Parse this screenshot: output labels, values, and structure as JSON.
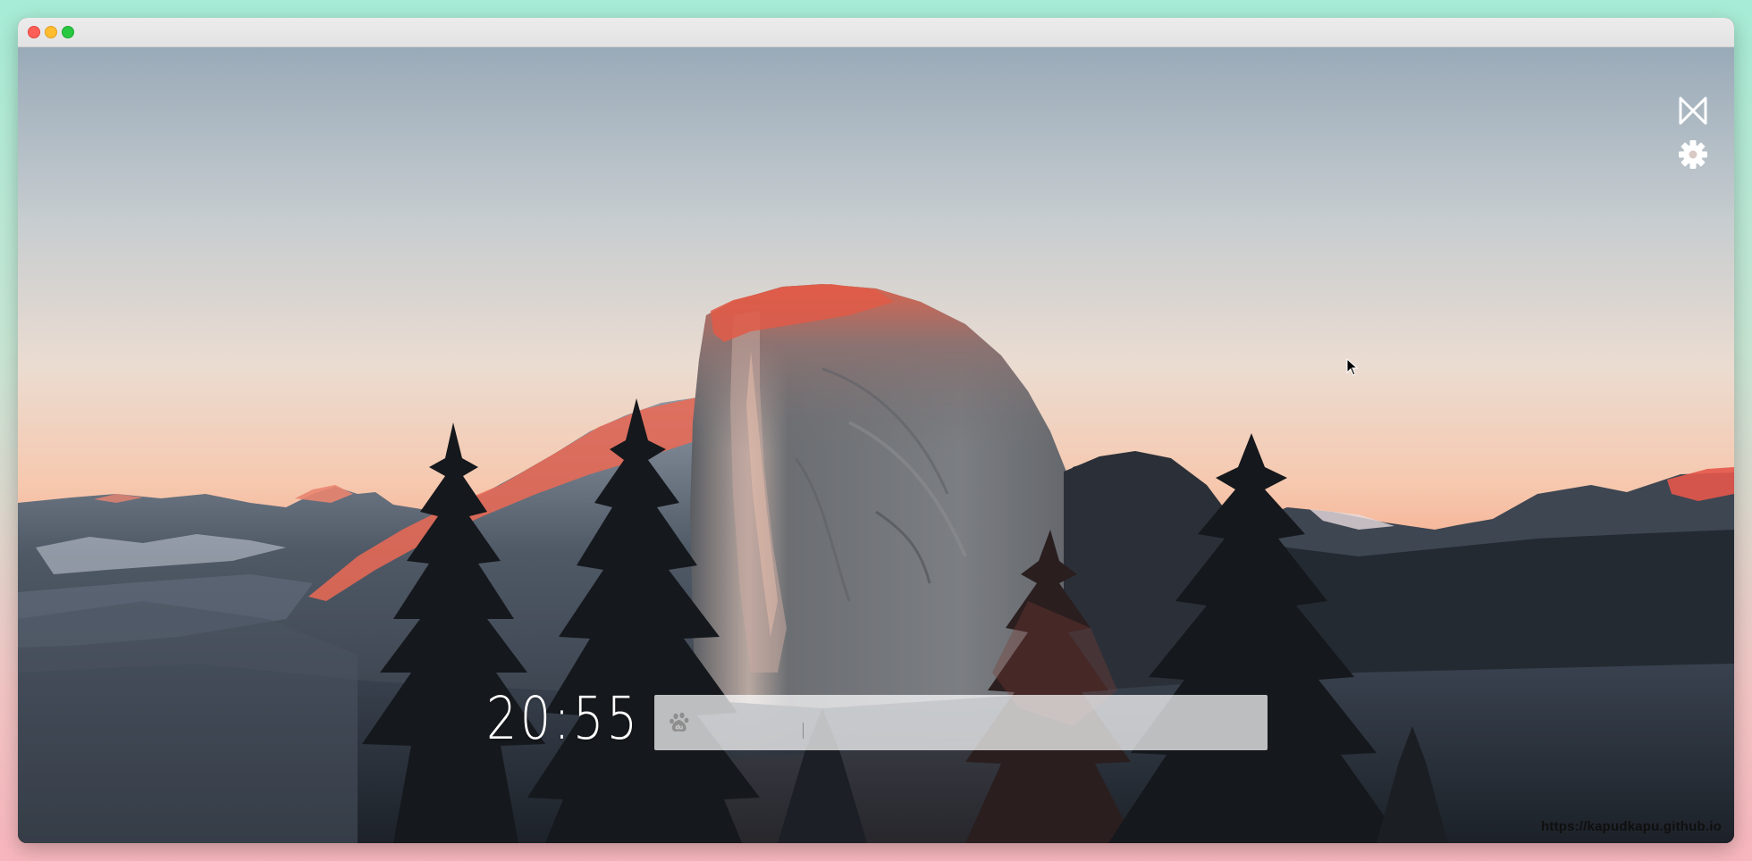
{
  "window": {
    "buttons": {
      "close": "close",
      "minimize": "minimize",
      "maximize": "maximize"
    }
  },
  "colors": {
    "sky_top": "#9aabb8",
    "sky_mid": "#e9d7cd",
    "sky_horizon": "#f7a07f",
    "alpenglow": "#f0644c",
    "rock": "#6f7276",
    "trees": "#16191d"
  },
  "clock": {
    "time": "20:55"
  },
  "search": {
    "engine_icon": "baidu-paw-icon",
    "value": "",
    "placeholder": ""
  },
  "toolbar": {
    "logo_icon": "bowtie-logo-icon",
    "settings_icon": "gear-icon"
  },
  "footer": {
    "link_text": "https://kapudkapu.github.io"
  }
}
